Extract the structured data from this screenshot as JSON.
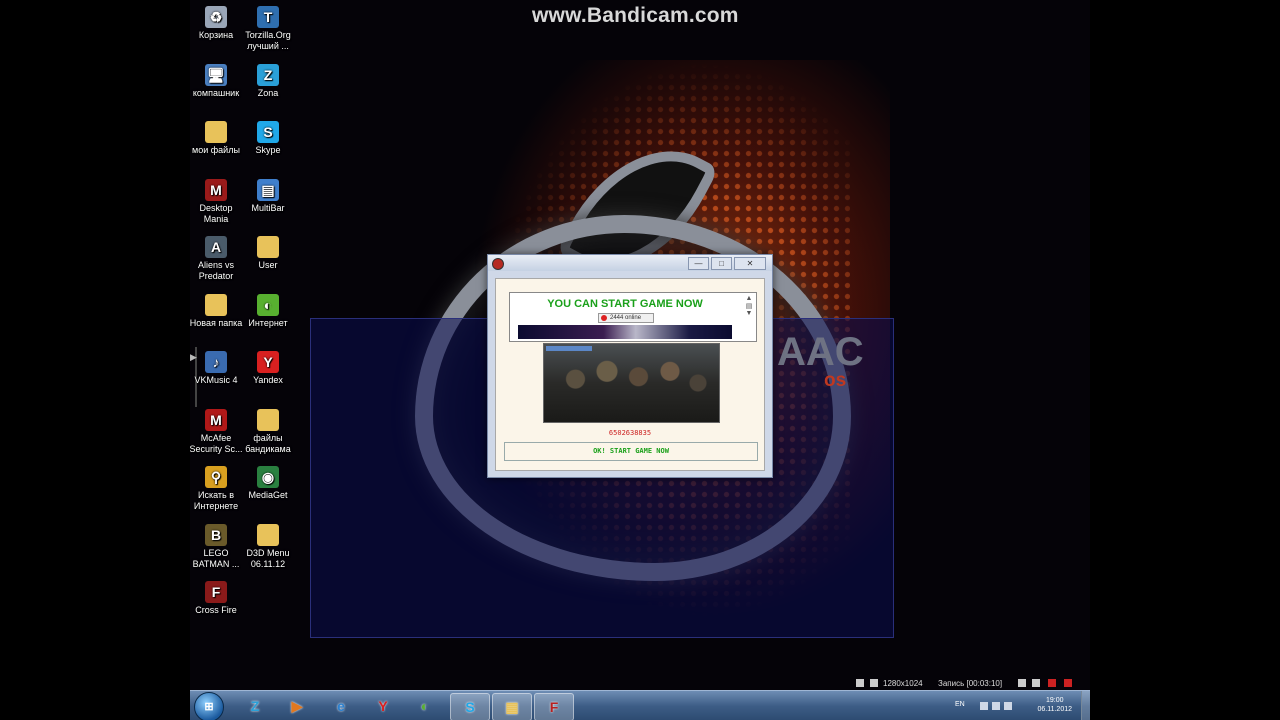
{
  "watermark": "www.Bandicam.com",
  "wallpaper": {
    "brand": "AAC",
    "os": "os"
  },
  "desktop_icons": [
    {
      "label": "Корзина",
      "icon": "recycle-bin-icon",
      "glyph": "♻",
      "color": "#9aa6b8"
    },
    {
      "label": "Torzilla.Org лучший ...",
      "icon": "torzilla-icon",
      "glyph": "T",
      "color": "#2f6fb0"
    },
    {
      "label": "компашник",
      "icon": "computer-icon",
      "glyph": "🖥",
      "color": "#4a7fc0"
    },
    {
      "label": "Zona",
      "icon": "zona-icon",
      "glyph": "Z",
      "color": "#2aa0d8"
    },
    {
      "label": "мои файлы",
      "icon": "folder-icon",
      "glyph": "",
      "color": "#e8c25a"
    },
    {
      "label": "Skype",
      "icon": "skype-icon",
      "glyph": "S",
      "color": "#20a8e8"
    },
    {
      "label": "Desktop Mania",
      "icon": "desktop-mania-icon",
      "glyph": "M",
      "color": "#9a1a1a"
    },
    {
      "label": "MultiBar",
      "icon": "multibar-icon",
      "glyph": "▤",
      "color": "#3f7fcc"
    },
    {
      "label": "Aliens vs Predator",
      "icon": "aliens-vs-predator-icon",
      "glyph": "A",
      "color": "#4a5b6a"
    },
    {
      "label": "User",
      "icon": "folder-icon",
      "glyph": "",
      "color": "#e8c25a"
    },
    {
      "label": "Новая папка",
      "icon": "folder-icon",
      "glyph": "",
      "color": "#e8c25a"
    },
    {
      "label": "Интернет",
      "icon": "internet-icon",
      "glyph": "◐",
      "color": "#58b030"
    },
    {
      "label": "VKMusic 4",
      "icon": "vkmusic-icon",
      "glyph": "♪",
      "color": "#3a6bb0"
    },
    {
      "label": "Yandex",
      "icon": "yandex-icon",
      "glyph": "Y",
      "color": "#d82020"
    },
    {
      "label": "McAfee Security Sc...",
      "icon": "mcafee-icon",
      "glyph": "M",
      "color": "#b01818"
    },
    {
      "label": "файлы бандикама",
      "icon": "folder-icon",
      "glyph": "",
      "color": "#e8c25a"
    },
    {
      "label": "Искать в Интернете",
      "icon": "search-web-icon",
      "glyph": "⚲",
      "color": "#d9a020"
    },
    {
      "label": "MediaGet",
      "icon": "mediaget-icon",
      "glyph": "◉",
      "color": "#2a8040"
    },
    {
      "label": "LEGO BATMAN ...",
      "icon": "lego-batman-icon",
      "glyph": "B",
      "color": "#6a5a2a"
    },
    {
      "label": "D3D Menu 06.11.12",
      "icon": "folder-icon",
      "glyph": "",
      "color": "#e8c25a"
    },
    {
      "label": "Cross Fire",
      "icon": "crossfire-icon",
      "glyph": "F",
      "color": "#8a1a1a"
    }
  ],
  "dialog": {
    "title": "",
    "min": "—",
    "max": "□",
    "close": "✕",
    "banner_title": "YOU CAN START GAME NOW",
    "online_text": "2444 online",
    "code": "6502638835",
    "start_button": "OK! START GAME NOW"
  },
  "bandicam_bar": {
    "resolution": "1280x1024",
    "recording": "Запись [00:03:10]"
  },
  "taskbar": {
    "start": "⊞",
    "items": [
      {
        "icon": "zona-icon",
        "glyph": "Z",
        "color": "#2aa0d8"
      },
      {
        "icon": "media-player-icon",
        "glyph": "▶",
        "color": "#e07820"
      },
      {
        "icon": "internet-explorer-icon",
        "glyph": "e",
        "color": "#2a80d0"
      },
      {
        "icon": "yandex-icon",
        "glyph": "Y",
        "color": "#d82020"
      },
      {
        "icon": "internet-icon",
        "glyph": "◐",
        "color": "#58b030"
      },
      {
        "icon": "skype-icon",
        "glyph": "S",
        "color": "#20a8e8"
      },
      {
        "icon": "folder-icon",
        "glyph": "▦",
        "color": "#e8c25a"
      },
      {
        "icon": "crossfire-icon",
        "glyph": "F",
        "color": "#b82020"
      }
    ],
    "lang": "EN",
    "time": "19:00",
    "date": "06.11.2012"
  }
}
